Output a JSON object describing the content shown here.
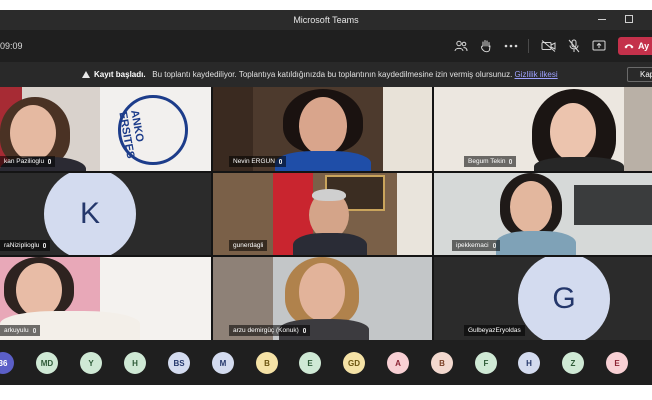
{
  "window": {
    "title": "Microsoft Teams"
  },
  "toolbar": {
    "timer": "09:09",
    "leave_label": "Ay"
  },
  "banner": {
    "bold": "Kayıt başladı.",
    "message": "Bu toplantı kaydediliyor. Toplantıya katıldığınızda bu toplantının kaydedilmesine izin vermiş olursunuz.",
    "link": "Gizlilik ilkesi",
    "button": "Kap"
  },
  "participants": [
    {
      "name": "kan Pazilioglu"
    },
    {
      "name": "Nevin ERGUN"
    },
    {
      "name": "Begum Tekin"
    },
    {
      "name": "raNiziplioglu",
      "avatar": "K"
    },
    {
      "name": "gunerdagli"
    },
    {
      "name": "ipekkemaci"
    },
    {
      "name": "arkuyulu"
    },
    {
      "name": "arzu demirgüç (Konuk)"
    },
    {
      "name": "GulbeyazEryoldas",
      "avatar": "G"
    }
  ],
  "tile_logo": "ANKO\nERSITES",
  "roster": [
    {
      "initials": "36",
      "color": "#5b5fc7",
      "text": "#ffffff"
    },
    {
      "initials": "MD",
      "color": "#cfe9d5",
      "text": "#2d5a37"
    },
    {
      "initials": "Y",
      "color": "#cfe9d5",
      "text": "#2d5a37"
    },
    {
      "initials": "H",
      "color": "#cfe9d5",
      "text": "#2d5a37"
    },
    {
      "initials": "BS",
      "color": "#d3dbef",
      "text": "#24376b"
    },
    {
      "initials": "M",
      "color": "#d3dbef",
      "text": "#24376b"
    },
    {
      "initials": "B",
      "color": "#f5e2a6",
      "text": "#6b5410"
    },
    {
      "initials": "E",
      "color": "#cfe9d5",
      "text": "#2d5a37"
    },
    {
      "initials": "GD",
      "color": "#f5e2a6",
      "text": "#6b5410"
    },
    {
      "initials": "A",
      "color": "#f8d0d4",
      "text": "#8a2232"
    },
    {
      "initials": "B",
      "color": "#f3d9cf",
      "text": "#7a3f25"
    },
    {
      "initials": "F",
      "color": "#cfe9d5",
      "text": "#2d5a37"
    },
    {
      "initials": "H",
      "color": "#d3dbef",
      "text": "#24376b"
    },
    {
      "initials": "Z",
      "color": "#cfe9d5",
      "text": "#2d5a37"
    },
    {
      "initials": "E",
      "color": "#f8d0d4",
      "text": "#8a2232"
    }
  ]
}
